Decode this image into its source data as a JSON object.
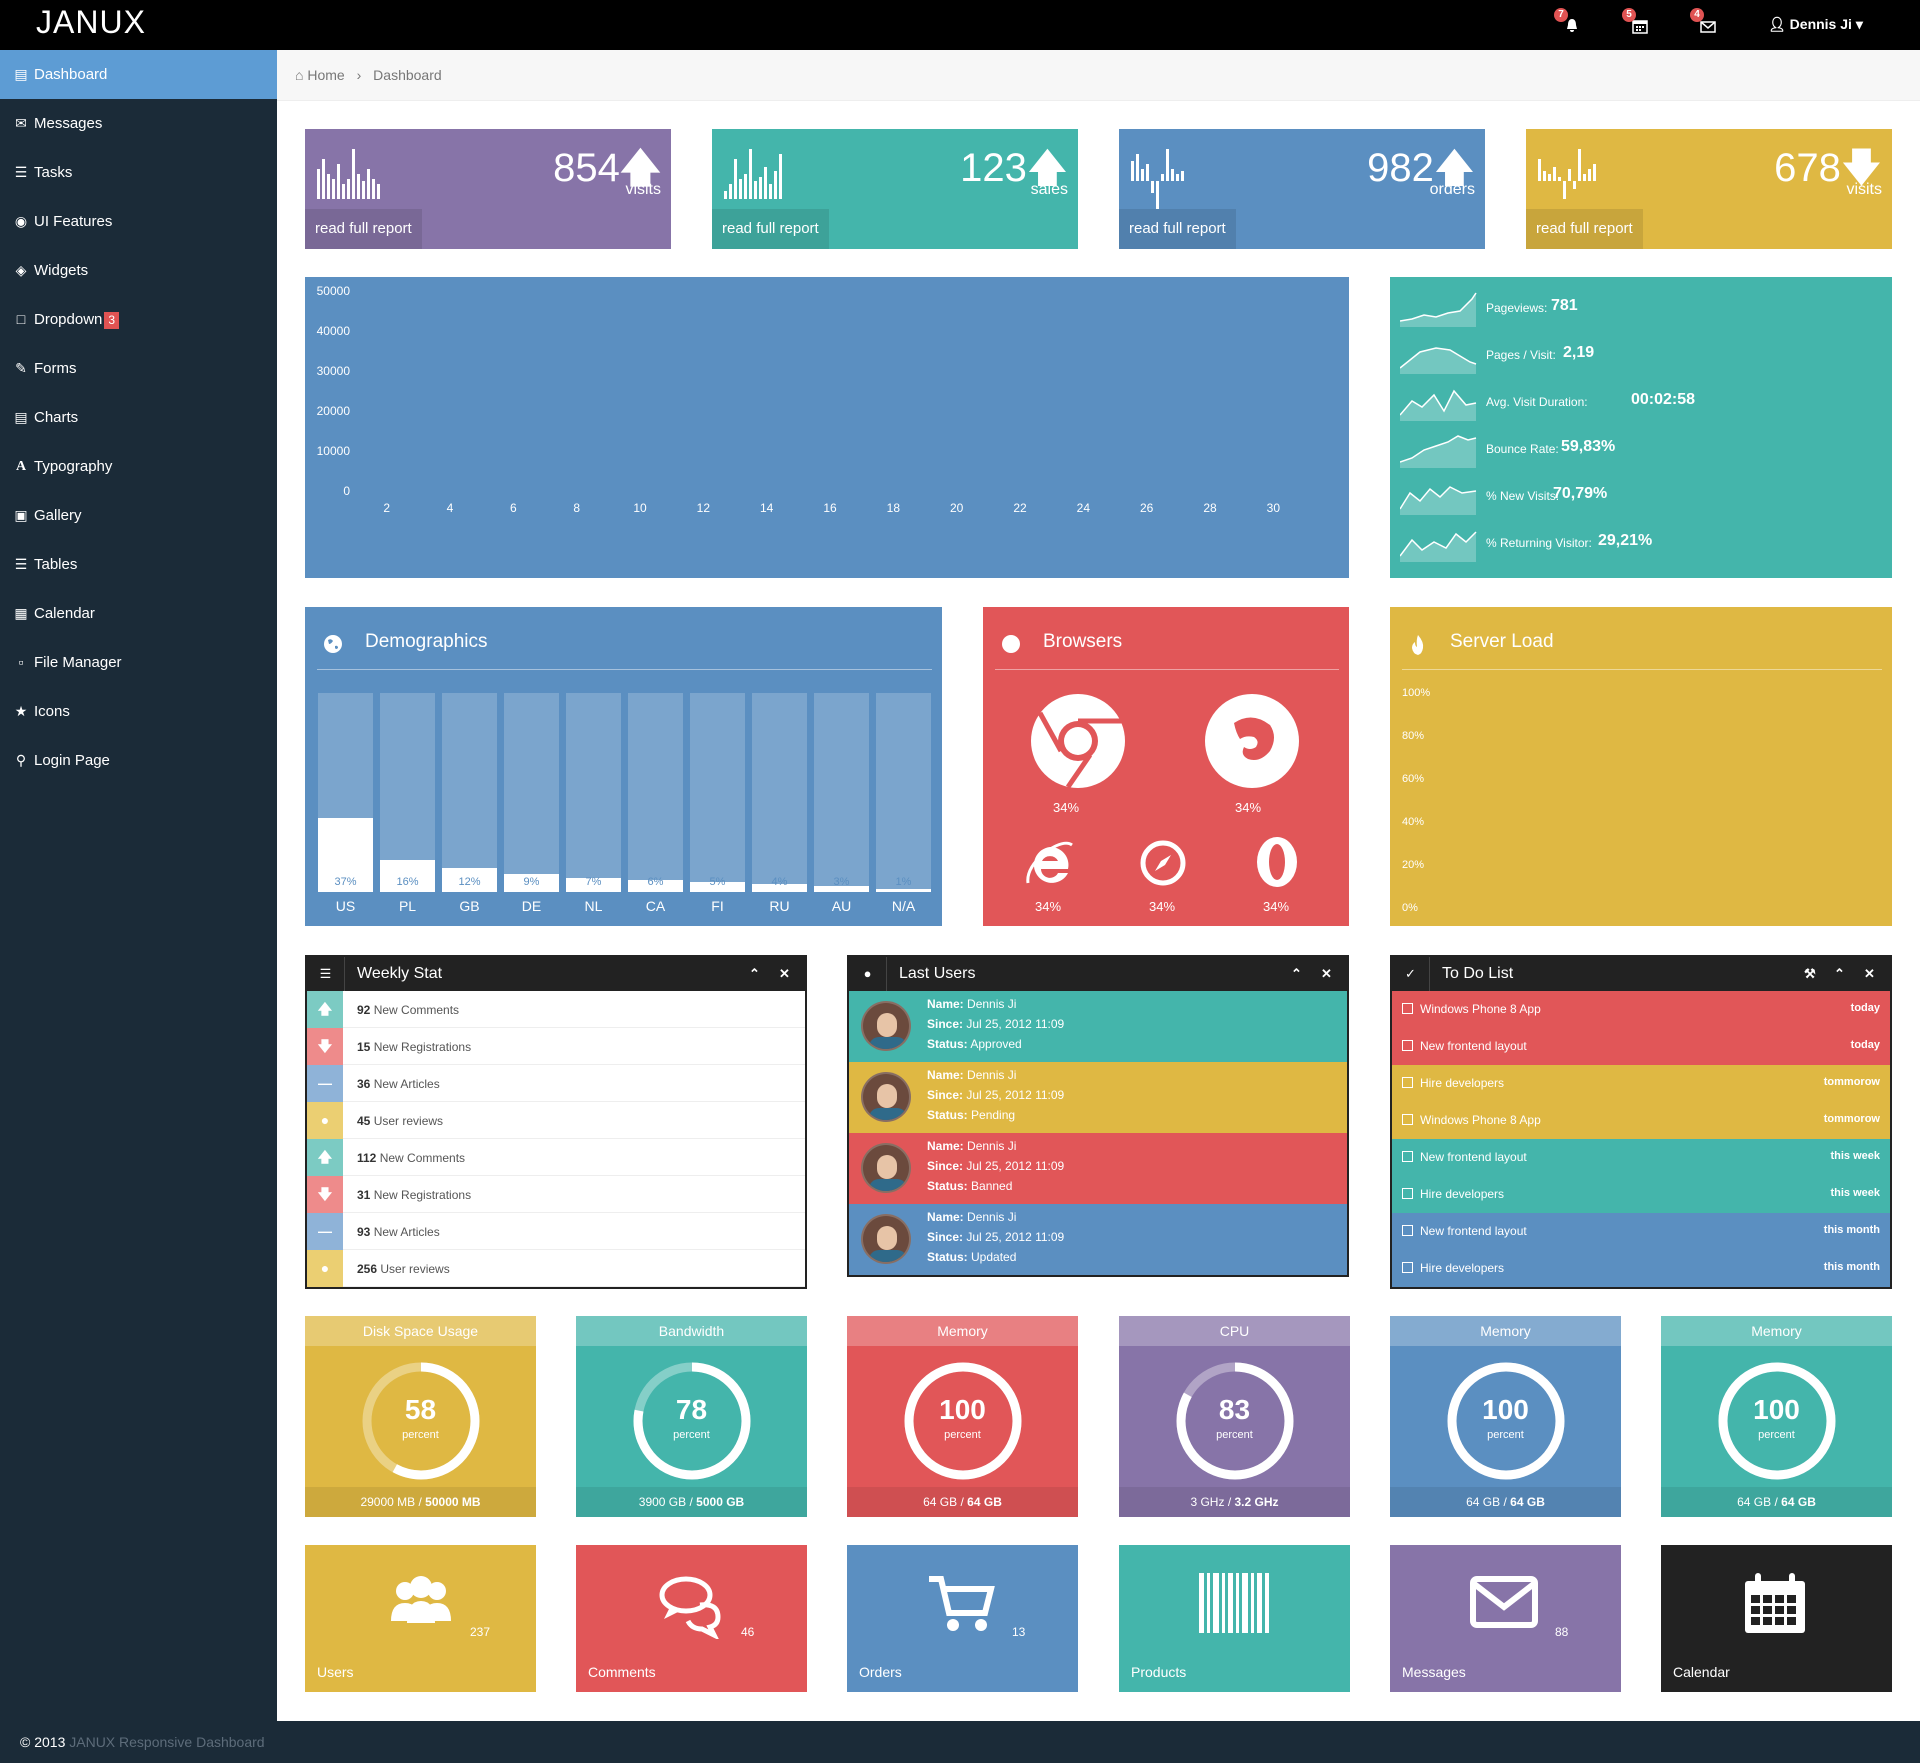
{
  "app": {
    "title": "JANUX"
  },
  "nav": {
    "badges": [
      "7",
      "5",
      "4"
    ],
    "user": "Dennis Ji"
  },
  "sidebar": {
    "items": [
      {
        "label": "Dashboard",
        "icon": "bar-chart-icon",
        "active": true
      },
      {
        "label": "Messages",
        "icon": "envelope-icon"
      },
      {
        "label": "Tasks",
        "icon": "tasks-icon"
      },
      {
        "label": "UI Features",
        "icon": "eye-icon"
      },
      {
        "label": "Widgets",
        "icon": "dashboard-icon"
      },
      {
        "label": "Dropdown",
        "icon": "folder-icon",
        "badge": "3"
      },
      {
        "label": "Forms",
        "icon": "edit-icon"
      },
      {
        "label": "Charts",
        "icon": "list-alt-icon"
      },
      {
        "label": "Typography",
        "icon": "font-icon"
      },
      {
        "label": "Gallery",
        "icon": "picture-icon"
      },
      {
        "label": "Tables",
        "icon": "align-justify-icon"
      },
      {
        "label": "Calendar",
        "icon": "calendar-icon"
      },
      {
        "label": "File Manager",
        "icon": "folder-open-icon"
      },
      {
        "label": "Icons",
        "icon": "star-icon"
      },
      {
        "label": "Login Page",
        "icon": "lock-icon"
      }
    ]
  },
  "breadcrumb": {
    "home": "Home",
    "current": "Dashboard"
  },
  "stats": [
    {
      "value": "854",
      "unit": "visits",
      "trend": "up",
      "link": "read full report"
    },
    {
      "value": "123",
      "unit": "sales",
      "trend": "up",
      "link": "read full report"
    },
    {
      "value": "982",
      "unit": "orders",
      "trend": "up",
      "link": "read full report"
    },
    {
      "value": "678",
      "unit": "visits",
      "trend": "down",
      "link": "read full report"
    }
  ],
  "chart_data": [
    {
      "type": "line",
      "x_ticks": [
        "2",
        "4",
        "6",
        "8",
        "10",
        "12",
        "14",
        "16",
        "18",
        "20",
        "22",
        "24",
        "26",
        "28",
        "30"
      ],
      "y_ticks": [
        "50000",
        "40000",
        "30000",
        "20000",
        "10000",
        "0"
      ],
      "ylim": [
        0,
        50000
      ],
      "xlim": [
        1,
        31
      ]
    },
    {
      "type": "bar",
      "categories": [
        "US",
        "PL",
        "GB",
        "DE",
        "NL",
        "CA",
        "FI",
        "RU",
        "AU",
        "N/A"
      ],
      "values": [
        37,
        16,
        12,
        9,
        7,
        6,
        5,
        4,
        3,
        1
      ],
      "labels": [
        "37%",
        "16%",
        "12%",
        "9%",
        "7%",
        "6%",
        "5%",
        "4%",
        "3%",
        "1%"
      ],
      "ylim": [
        0,
        100
      ]
    },
    {
      "type": "line",
      "y_ticks": [
        "100%",
        "80%",
        "60%",
        "40%",
        "20%",
        "0%"
      ],
      "ylim": [
        0,
        100
      ]
    }
  ],
  "analytics": [
    {
      "label": "Pageviews:",
      "value": "781"
    },
    {
      "label": "Pages / Visit:",
      "value": "2,19"
    },
    {
      "label": "Avg. Visit Duration:",
      "value": "00:02:58"
    },
    {
      "label": "Bounce Rate:",
      "value": "59,83%"
    },
    {
      "label": "% New Visits:",
      "value": "70,79%"
    },
    {
      "label": "% Returning Visitor:",
      "value": "29,21%"
    }
  ],
  "demographics": {
    "title": "Demographics"
  },
  "browsers": {
    "title": "Browsers",
    "items": [
      {
        "icon": "chrome-icon",
        "value": "34%"
      },
      {
        "icon": "firefox-icon",
        "value": "34%"
      },
      {
        "icon": "ie-icon",
        "value": "34%"
      },
      {
        "icon": "safari-icon",
        "value": "34%"
      },
      {
        "icon": "opera-icon",
        "value": "34%"
      }
    ]
  },
  "server_load": {
    "title": "Server Load"
  },
  "weekly_stat": {
    "title": "Weekly Stat",
    "rows": [
      {
        "count": "92",
        "text": "New Comments",
        "icon": "arrow-up-icon",
        "color": "#7ccbc3"
      },
      {
        "count": "15",
        "text": "New Registrations",
        "icon": "arrow-down-icon",
        "color": "#ee8b8b"
      },
      {
        "count": "36",
        "text": "New Articles",
        "icon": "minus-icon",
        "color": "#8fb3d8"
      },
      {
        "count": "45",
        "text": "User reviews",
        "icon": "comment-icon",
        "color": "#ebcf72"
      },
      {
        "count": "112",
        "text": "New Comments",
        "icon": "arrow-up-icon",
        "color": "#7ccbc3"
      },
      {
        "count": "31",
        "text": "New Registrations",
        "icon": "arrow-down-icon",
        "color": "#ee8b8b"
      },
      {
        "count": "93",
        "text": "New Articles",
        "icon": "minus-icon",
        "color": "#8fb3d8"
      },
      {
        "count": "256",
        "text": "User reviews",
        "icon": "comment-icon",
        "color": "#ebcf72"
      }
    ]
  },
  "last_users": {
    "title": "Last Users",
    "name_label": "Name:",
    "since_label": "Since:",
    "status_label": "Status:",
    "rows": [
      {
        "name": "Dennis Ji",
        "since": "Jul 25, 2012 11:09",
        "status": "Approved",
        "color": "#44b5ab"
      },
      {
        "name": "Dennis Ji",
        "since": "Jul 25, 2012 11:09",
        "status": "Pending",
        "color": "#dfb843"
      },
      {
        "name": "Dennis Ji",
        "since": "Jul 25, 2012 11:09",
        "status": "Banned",
        "color": "#e15658"
      },
      {
        "name": "Dennis Ji",
        "since": "Jul 25, 2012 11:09",
        "status": "Updated",
        "color": "#5b8fc1"
      }
    ]
  },
  "todo": {
    "title": "To Do List",
    "rows": [
      {
        "text": "Windows Phone 8 App",
        "when": "today",
        "color": "#e15658"
      },
      {
        "text": "New frontend layout",
        "when": "today",
        "color": "#e15658"
      },
      {
        "text": "Hire developers",
        "when": "tommorow",
        "color": "#dfb843"
      },
      {
        "text": "Windows Phone 8 App",
        "when": "tommorow",
        "color": "#dfb843"
      },
      {
        "text": "New frontend layout",
        "when": "this week",
        "color": "#44b5ab"
      },
      {
        "text": "Hire developers",
        "when": "this week",
        "color": "#44b5ab"
      },
      {
        "text": "New frontend layout",
        "when": "this month",
        "color": "#5b8fc1"
      },
      {
        "text": "Hire developers",
        "when": "this month",
        "color": "#5b8fc1"
      }
    ]
  },
  "gauges": [
    {
      "title": "Disk Space Usage",
      "value": "58",
      "percent": 58,
      "unit": "percent",
      "used": "29000 MB",
      "total": "50000 MB",
      "color": "#dfb843"
    },
    {
      "title": "Bandwidth",
      "value": "78",
      "percent": 78,
      "unit": "percent",
      "used": "3900 GB",
      "total": "5000 GB",
      "color": "#44b5ab"
    },
    {
      "title": "Memory",
      "value": "100",
      "percent": 100,
      "unit": "percent",
      "used": "64 GB",
      "total": "64 GB",
      "color": "#e15658"
    },
    {
      "title": "CPU",
      "value": "83",
      "percent": 83,
      "unit": "percent",
      "used": "3 GHz",
      "total": "3.2 GHz",
      "color": "#8774a8"
    },
    {
      "title": "Memory",
      "value": "100",
      "percent": 100,
      "unit": "percent",
      "used": "64 GB",
      "total": "64 GB",
      "color": "#5b8fc1"
    },
    {
      "title": "Memory",
      "value": "100",
      "percent": 100,
      "unit": "percent",
      "used": "64 GB",
      "total": "64 GB",
      "color": "#44b5ab"
    }
  ],
  "shortcuts": [
    {
      "label": "Users",
      "count": "237",
      "icon": "users-icon",
      "color": "#dfb843"
    },
    {
      "label": "Comments",
      "count": "46",
      "icon": "comments-icon",
      "color": "#e15658"
    },
    {
      "label": "Orders",
      "count": "13",
      "icon": "shopping-cart-icon",
      "color": "#5b8fc1"
    },
    {
      "label": "Products",
      "count": "",
      "icon": "barcode-icon",
      "color": "#44b5ab"
    },
    {
      "label": "Messages",
      "count": "88",
      "icon": "envelope-icon",
      "color": "#8774a8"
    },
    {
      "label": "Calendar",
      "count": "",
      "icon": "calendar-icon",
      "color": "#222222"
    }
  ],
  "footer": {
    "copyright": "© 2013",
    "brand": "JANUX Responsive Dashboard"
  }
}
